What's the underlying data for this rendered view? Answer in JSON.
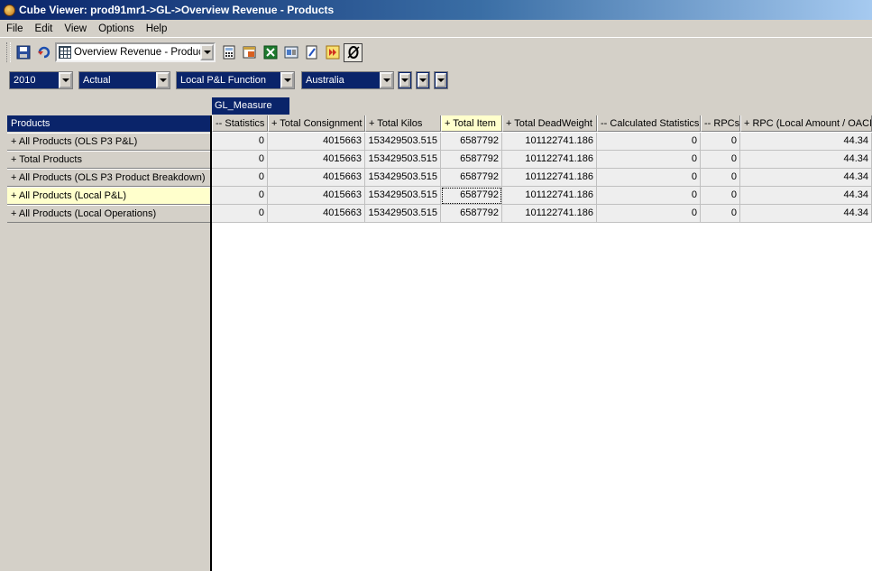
{
  "window": {
    "title": "Cube Viewer: prod91mr1->GL->Overview Revenue - Products"
  },
  "menu": [
    "File",
    "Edit",
    "View",
    "Options",
    "Help"
  ],
  "toolbar": {
    "view_name": "Overview Revenue - Product",
    "icons": [
      "save-icon",
      "recalc-icon",
      "view-icon",
      "calculator-icon",
      "cube-icon",
      "excel-icon",
      "sandbox-icon",
      "edit-icon",
      "forward-icon",
      "zero-suppress-icon"
    ]
  },
  "title_dims": [
    {
      "value": "2010"
    },
    {
      "value": "Actual"
    },
    {
      "value": "Local P&L Function"
    },
    {
      "value": "Australia"
    }
  ],
  "column_dimension": "GL_Measure",
  "row_dimension": "Products",
  "columns": [
    "-- Statistics",
    "+ Total Consignment",
    "+ Total Kilos",
    "+ Total Item",
    "+ Total DeadWeight",
    "-- Calculated Statistics",
    "-- RPCs",
    "+ RPC (Local Amount / OACN"
  ],
  "rows": [
    {
      "label": "+ All Products (OLS P3 P&L)",
      "values": [
        "0",
        "4015663",
        "153429503.515",
        "6587792",
        "101122741.186",
        "0",
        "0",
        "44.34"
      ]
    },
    {
      "label": "+ Total Products",
      "values": [
        "0",
        "4015663",
        "153429503.515",
        "6587792",
        "101122741.186",
        "0",
        "0",
        "44.34"
      ]
    },
    {
      "label": "+ All Products (OLS P3 Product Breakdown)",
      "values": [
        "0",
        "4015663",
        "153429503.515",
        "6587792",
        "101122741.186",
        "0",
        "0",
        "44.34"
      ]
    },
    {
      "label": "+ All Products (Local P&L)",
      "values": [
        "0",
        "4015663",
        "153429503.515",
        "6587792",
        "101122741.186",
        "0",
        "0",
        "44.34"
      ]
    },
    {
      "label": "+ All Products (Local Operations)",
      "values": [
        "0",
        "4015663",
        "153429503.515",
        "6587792",
        "101122741.186",
        "0",
        "0",
        "44.34"
      ]
    }
  ],
  "selection": {
    "row": 3,
    "column": 3
  },
  "colors": {
    "titlebar": "#0a246a",
    "highlight": "#ffffcc",
    "cell": "#eeeeee"
  }
}
